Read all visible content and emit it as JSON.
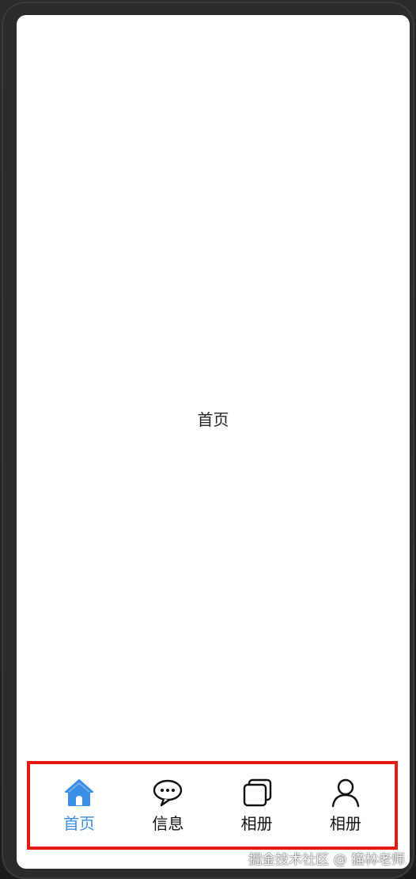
{
  "page": {
    "title": "首页"
  },
  "tabbar": {
    "tabs": [
      {
        "label": "首页",
        "icon": "home-icon",
        "active": true
      },
      {
        "label": "信息",
        "icon": "chat-bubble-icon",
        "active": false
      },
      {
        "label": "相册",
        "icon": "photo-stack-icon",
        "active": false
      },
      {
        "label": "相册",
        "icon": "person-icon",
        "active": false
      }
    ],
    "active_color": "#3b8ee6",
    "highlight_border_color": "#e8190e"
  },
  "watermark": {
    "text": "掘金技术社区 @ 猫林老师"
  }
}
